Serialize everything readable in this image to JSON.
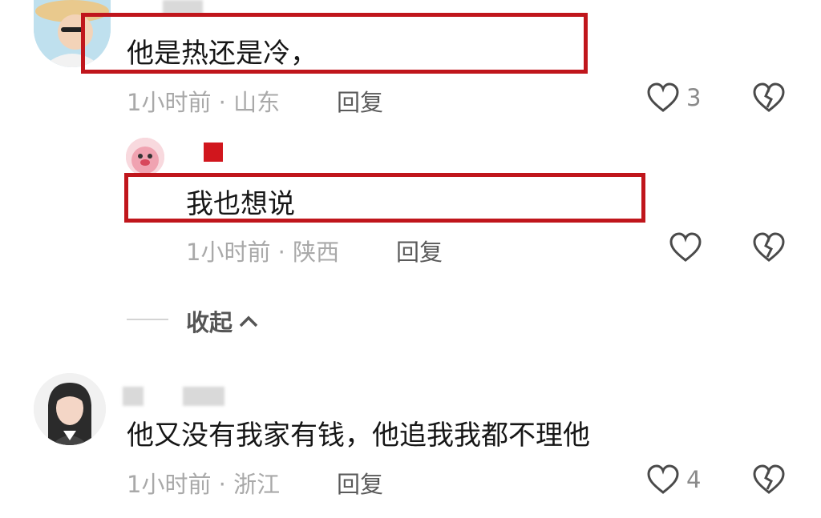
{
  "comments": [
    {
      "text": "他是热还是冷，",
      "meta": "1小时前 · 山东",
      "reply_label": "回复",
      "likes": "3",
      "avatar_icon": "user-avatar-hat"
    },
    {
      "text": "我也想说",
      "meta": "1小时前 · 陕西",
      "reply_label": "回复",
      "likes": "",
      "avatar_icon": "user-avatar-pink-character"
    },
    {
      "text": "他又没有我家有钱，他追我我都不理他",
      "meta": "1小时前 · 浙江",
      "reply_label": "回复",
      "likes": "4",
      "avatar_icon": "user-avatar-girl"
    }
  ],
  "collapse_label": "收起",
  "colors": {
    "highlight": "#c0161c",
    "meta": "#a9a9a9"
  }
}
